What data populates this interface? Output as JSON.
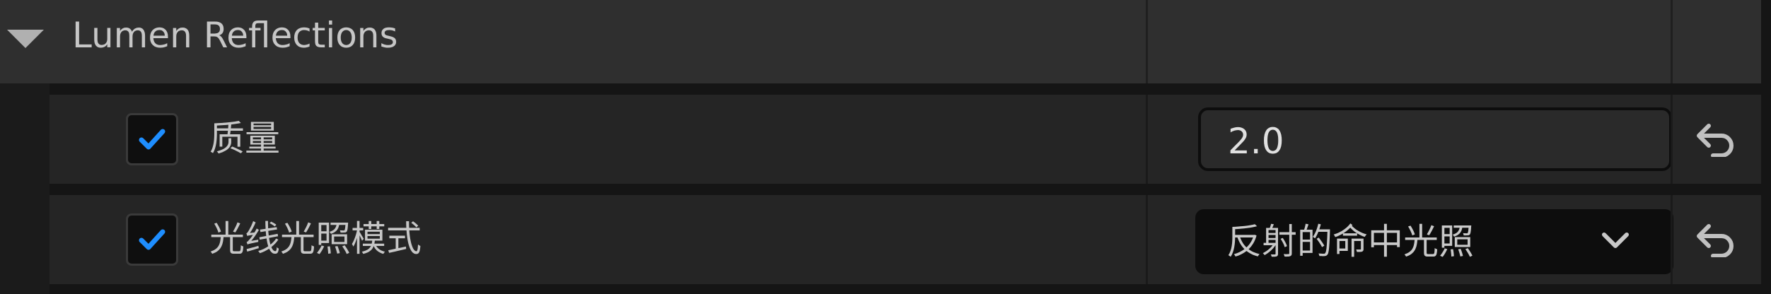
{
  "category": {
    "title": "Lumen Reflections",
    "expanded": true,
    "expander_icon": "triangle-down-icon"
  },
  "properties": [
    {
      "label": "质量",
      "enabled": true,
      "editor": "number",
      "value": "2.0",
      "reset_icon": "reset-arrow-icon"
    },
    {
      "label": "光线光照模式",
      "enabled": true,
      "editor": "combo",
      "value": "反射的命中光照",
      "dropdown_icon": "chevron-down-icon",
      "reset_icon": "reset-arrow-icon"
    }
  ],
  "colors": {
    "checkmark": "#1e8eff",
    "background": "#151515",
    "header": "#2f2f2f",
    "row": "#252525"
  }
}
